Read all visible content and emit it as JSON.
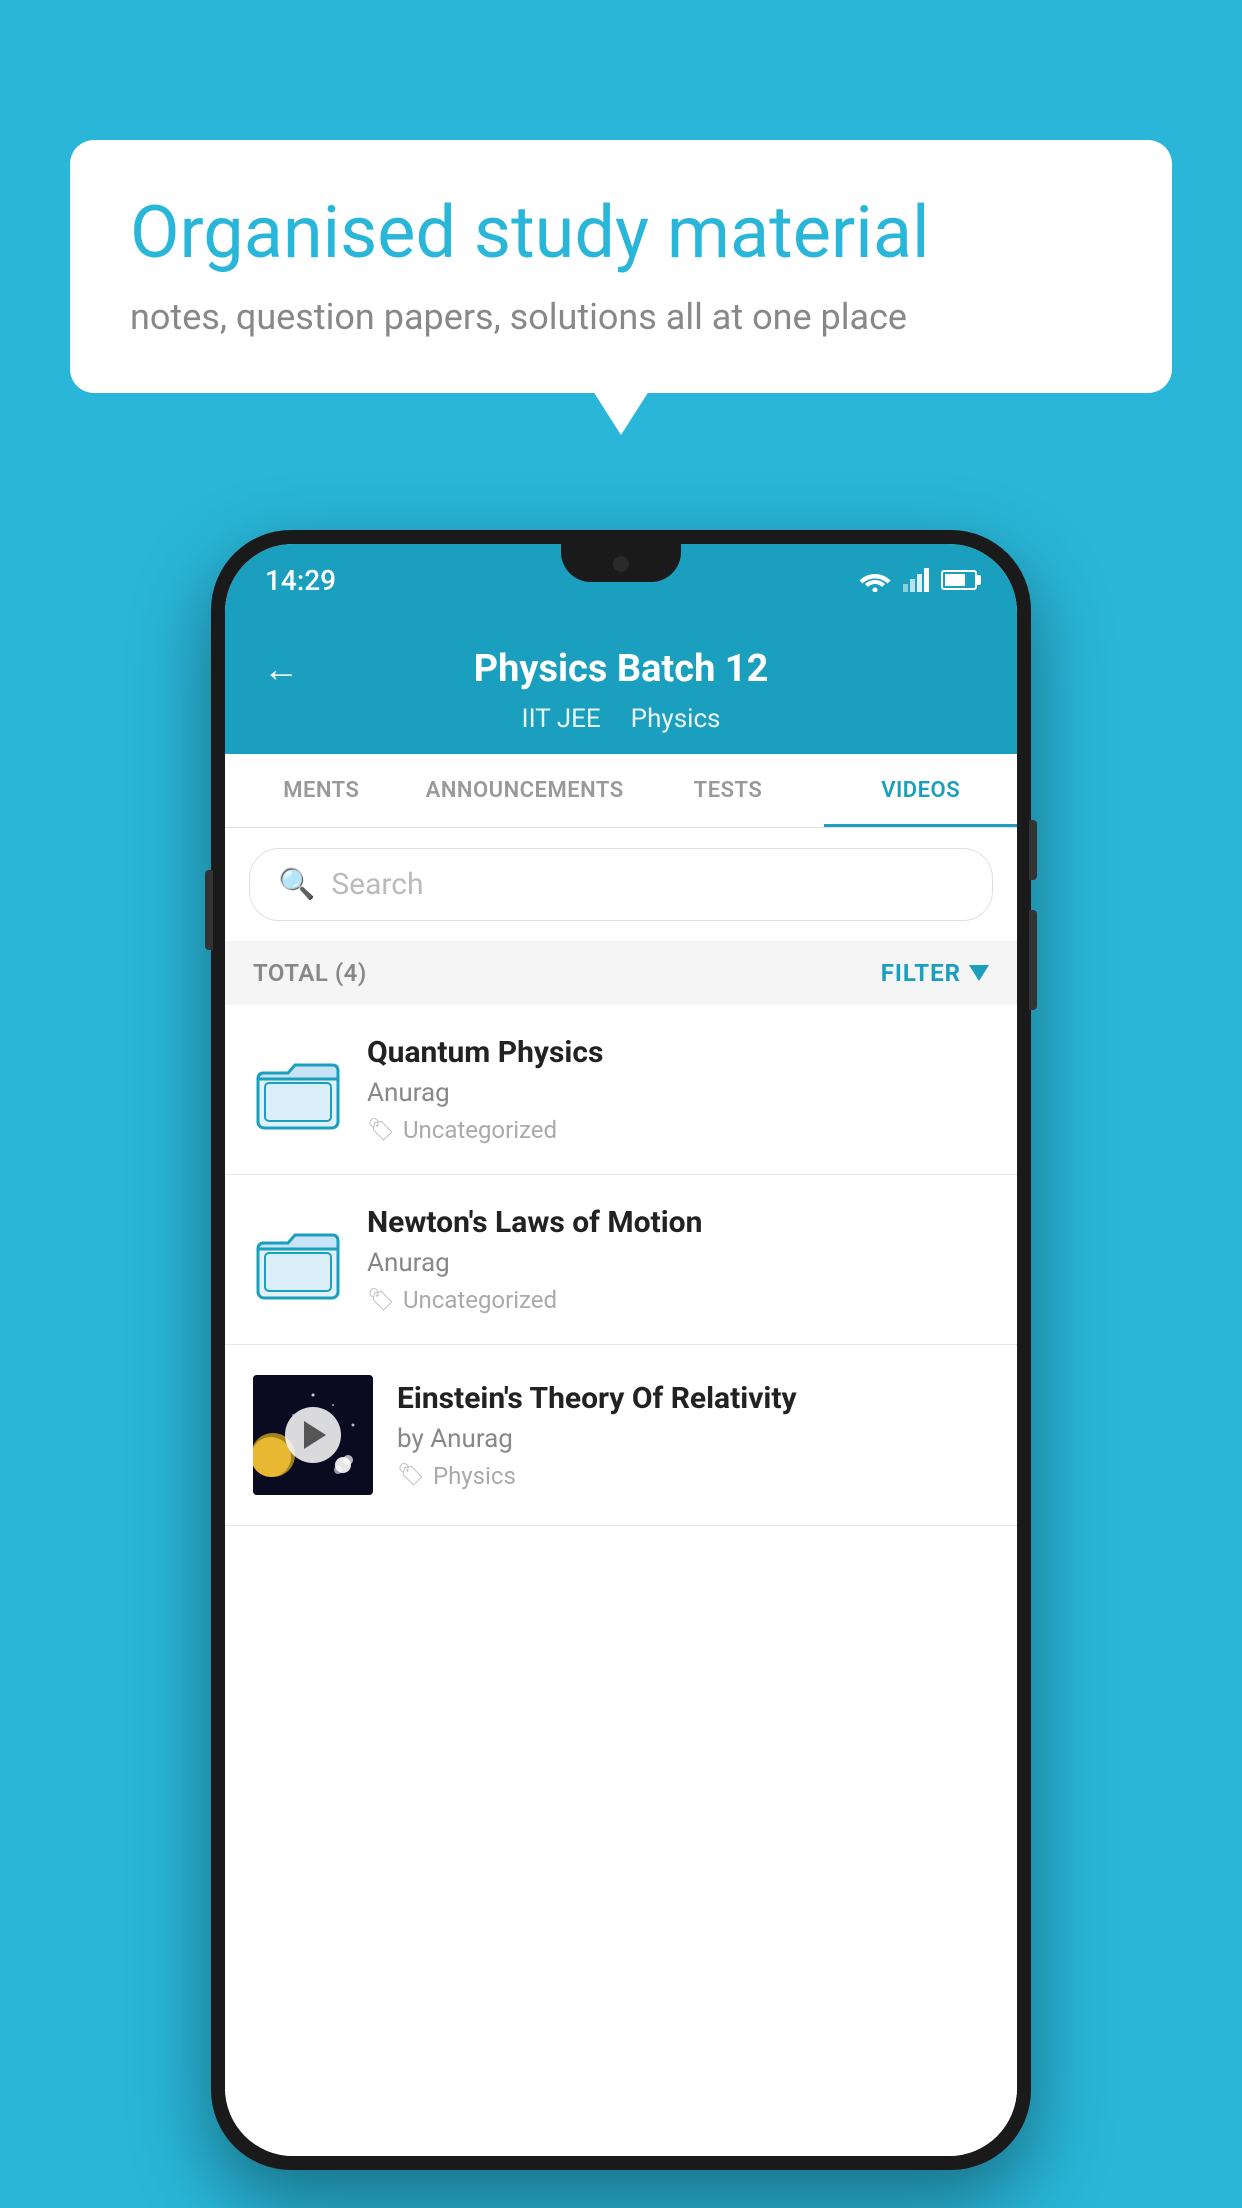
{
  "background": {
    "color": "#29b6d8"
  },
  "speech_bubble": {
    "title": "Organised study material",
    "subtitle": "notes, question papers, solutions all at one place"
  },
  "status_bar": {
    "time": "14:29"
  },
  "app_header": {
    "title": "Physics Batch 12",
    "subtitle_part1": "IIT JEE",
    "subtitle_part2": "Physics"
  },
  "tabs": [
    {
      "label": "MENTS",
      "active": false
    },
    {
      "label": "ANNOUNCEMENTS",
      "active": false
    },
    {
      "label": "TESTS",
      "active": false
    },
    {
      "label": "VIDEOS",
      "active": true
    }
  ],
  "search": {
    "placeholder": "Search"
  },
  "filter_bar": {
    "total_label": "TOTAL (4)",
    "filter_label": "FILTER"
  },
  "videos": [
    {
      "id": 1,
      "title": "Quantum Physics",
      "author": "Anurag",
      "tag": "Uncategorized",
      "has_thumbnail": false
    },
    {
      "id": 2,
      "title": "Newton's Laws of Motion",
      "author": "Anurag",
      "tag": "Uncategorized",
      "has_thumbnail": false
    },
    {
      "id": 3,
      "title": "Einstein's Theory Of Relativity",
      "author": "by Anurag",
      "tag": "Physics",
      "has_thumbnail": true
    }
  ]
}
